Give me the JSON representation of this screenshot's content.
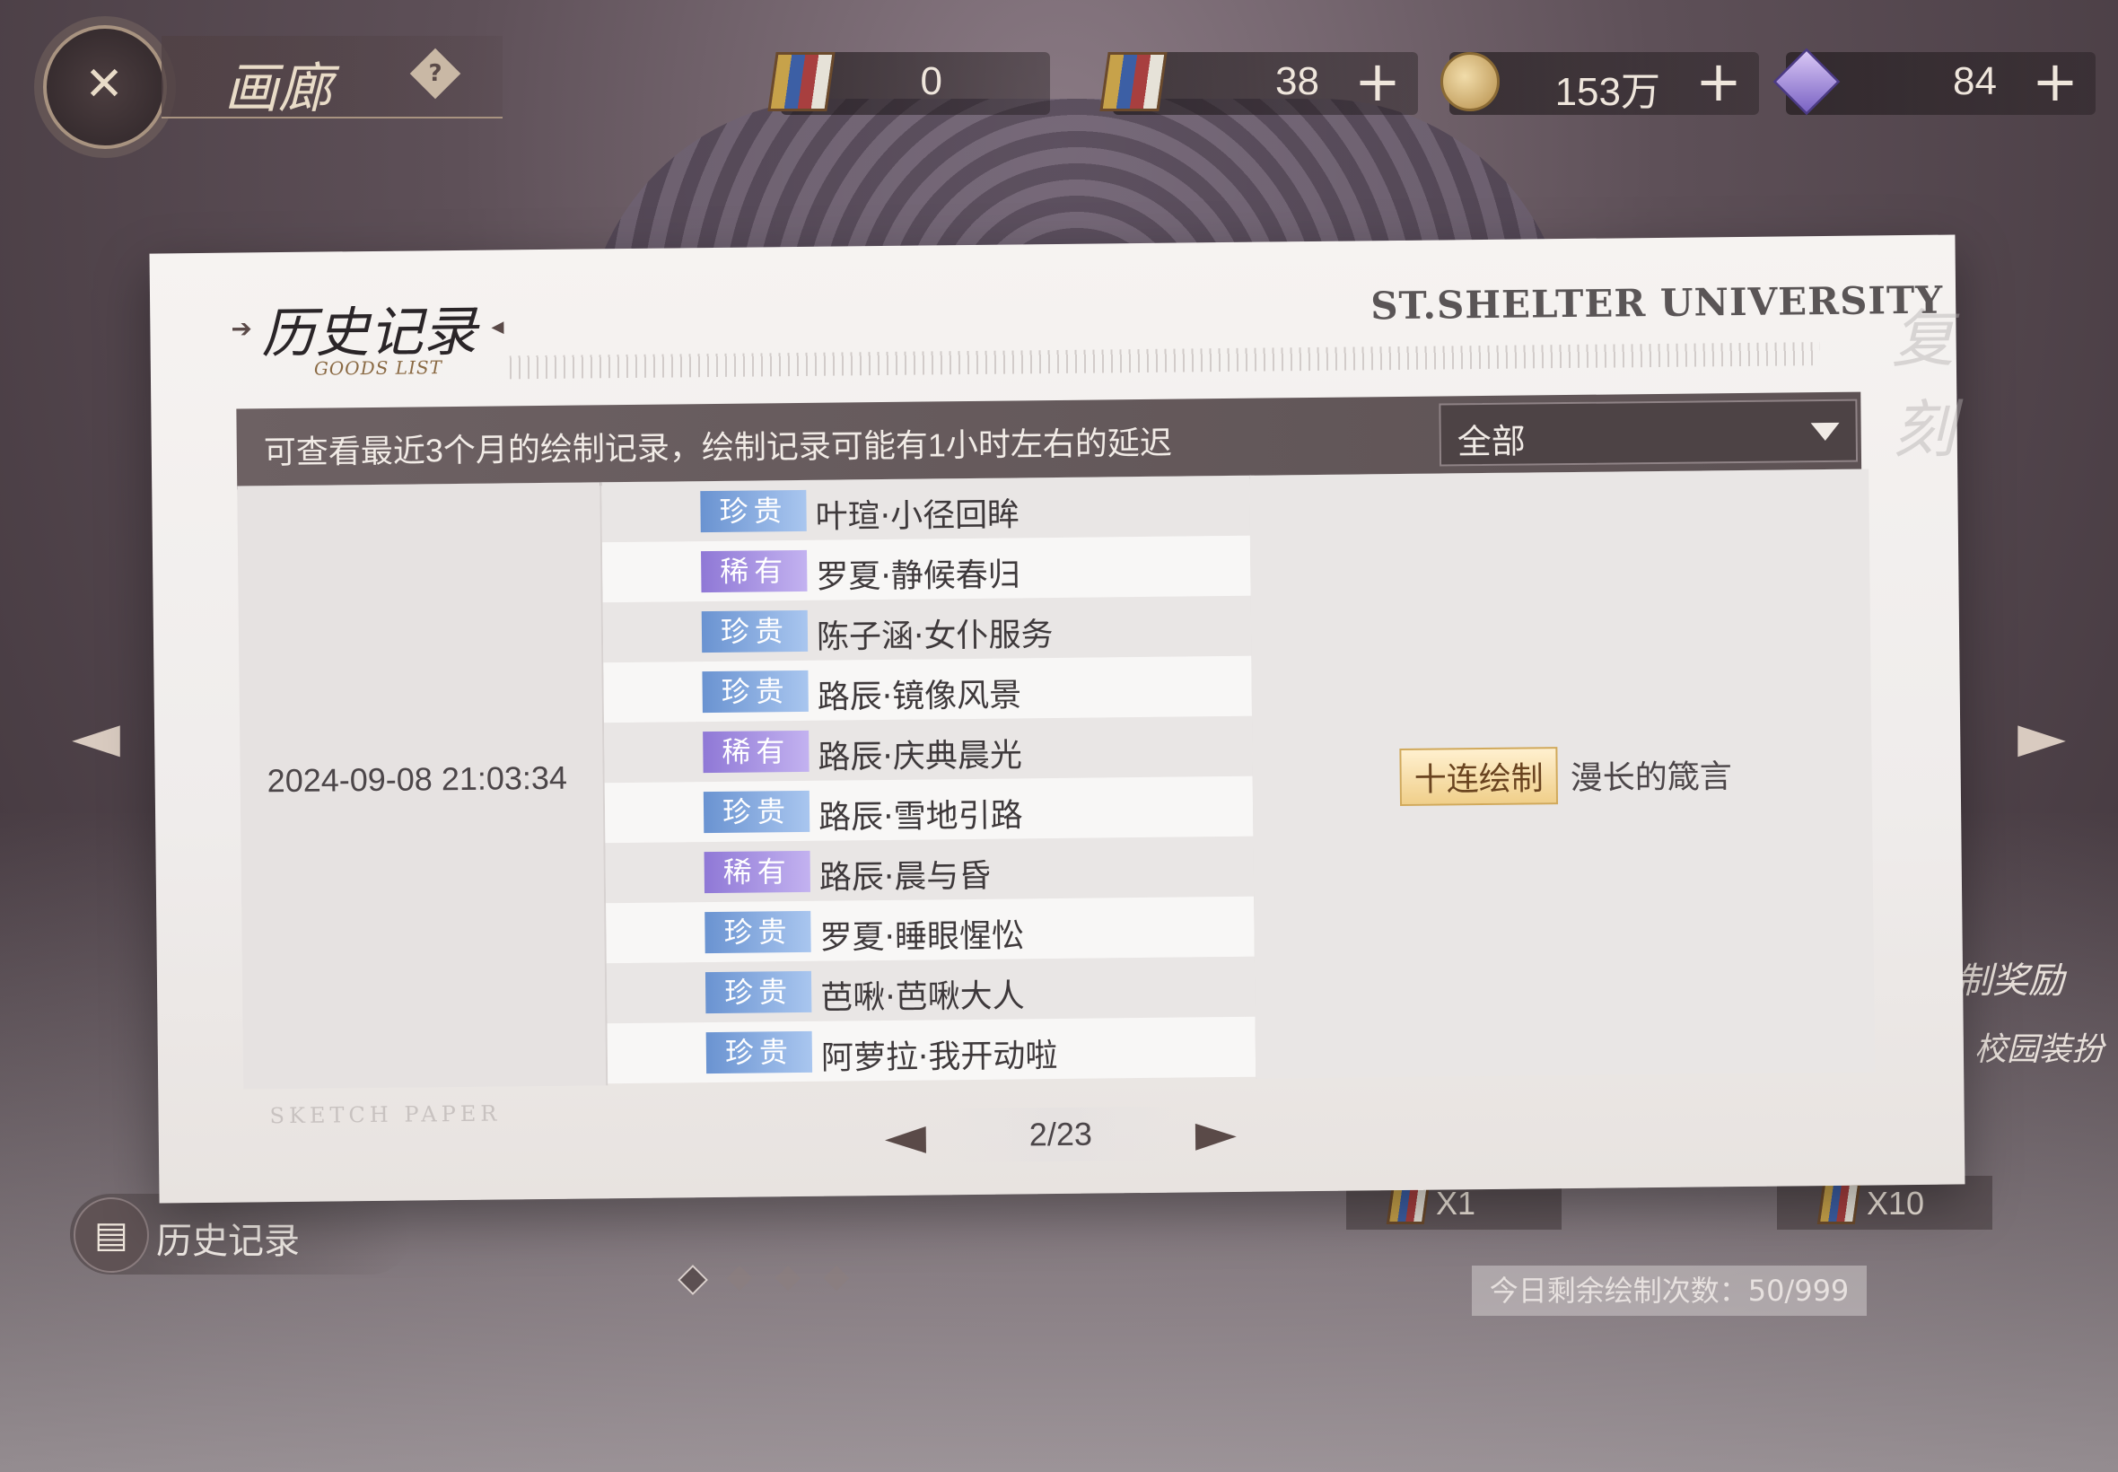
{
  "header": {
    "title": "画廊",
    "help_glyph": "?",
    "currencies": [
      {
        "icon": "paint-icon",
        "value": "0",
        "has_plus": false
      },
      {
        "icon": "paint-icon",
        "value": "38",
        "has_plus": true
      },
      {
        "icon": "coin-icon",
        "value": "153万",
        "has_plus": true
      },
      {
        "icon": "gem-icon",
        "value": "84",
        "has_plus": true
      }
    ]
  },
  "modal": {
    "title": "历史记录",
    "subtitle": "GOODS LIST",
    "university": "ST.SHELTER UNIVERSITY",
    "stamp": "复刻",
    "info_text": "可查看最近3个月的绘制记录，绘制记录可能有1小时左右的延迟",
    "filter_value": "全部",
    "record": {
      "date": "2024-09-08  21:03:34",
      "type": "十连绘制",
      "pool": "漫长的箴言",
      "items": [
        {
          "rarity": "珍贵",
          "rarity_class": "precious",
          "name": "叶瑄·小径回眸"
        },
        {
          "rarity": "稀有",
          "rarity_class": "rare",
          "name": "罗夏·静候春归"
        },
        {
          "rarity": "珍贵",
          "rarity_class": "precious",
          "name": "陈子涵·女仆服务"
        },
        {
          "rarity": "珍贵",
          "rarity_class": "precious",
          "name": "路辰·镜像风景"
        },
        {
          "rarity": "稀有",
          "rarity_class": "rare",
          "name": "路辰·庆典晨光"
        },
        {
          "rarity": "珍贵",
          "rarity_class": "precious",
          "name": "路辰·雪地引路"
        },
        {
          "rarity": "稀有",
          "rarity_class": "rare",
          "name": "路辰·晨与昏"
        },
        {
          "rarity": "珍贵",
          "rarity_class": "precious",
          "name": "罗夏·睡眼惺忪"
        },
        {
          "rarity": "珍贵",
          "rarity_class": "precious",
          "name": "芭啾·芭啾大人"
        },
        {
          "rarity": "珍贵",
          "rarity_class": "precious",
          "name": "阿萝拉·我开动啦"
        }
      ]
    },
    "sketch_label": "SKETCH PAPER",
    "pagination": "2/23"
  },
  "bottom": {
    "history_label": "历史记录",
    "draw_x1": "X1",
    "draw_x10": "X10",
    "remaining": "今日剩余绘制次数：50/999",
    "reward_label": "制奖励",
    "campus_label": "校园装扮"
  },
  "colors": {
    "rare_badge": "#8f78d6",
    "precious_badge": "#6a93d1",
    "info_bar": "#6d6163",
    "tag_gold": "#f0cf8a"
  }
}
